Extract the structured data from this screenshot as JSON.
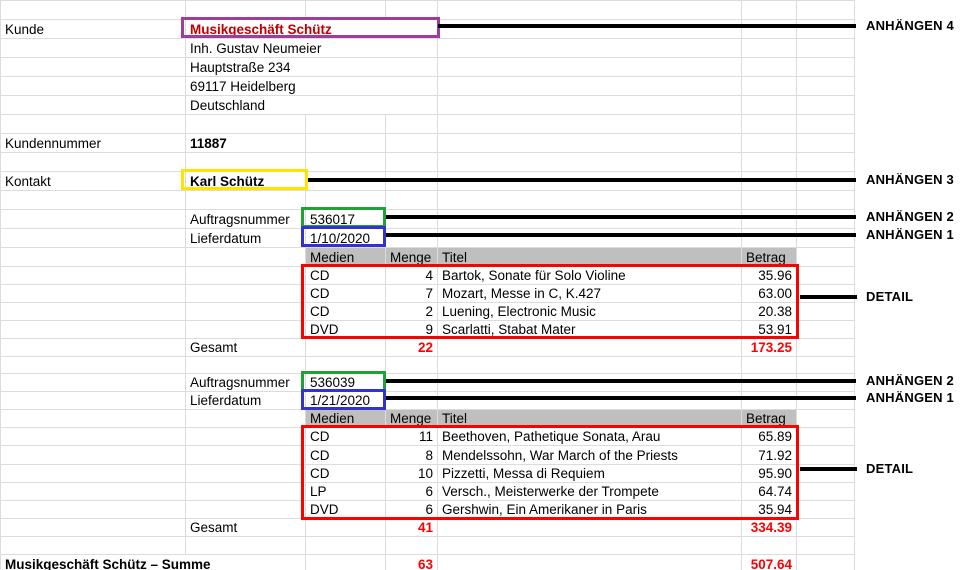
{
  "customer": {
    "label": "Kunde",
    "name": "Musikgeschäft Schütz",
    "address_lines": [
      "Inh. Gustav Neumeier",
      "Hauptstraße 234",
      "69117 Heidelberg",
      "Deutschland"
    ],
    "number_label": "Kundennummer",
    "number": "11887",
    "contact_label": "Kontakt",
    "contact": "Karl Schütz"
  },
  "orders": [
    {
      "order_number_label": "Auftragsnummer",
      "order_number": "536017",
      "delivery_date_label": "Lieferdatum",
      "delivery_date": "1/10/2020",
      "columns": [
        "Medien",
        "Menge",
        "Titel",
        "Betrag"
      ],
      "rows": [
        {
          "medien": "CD",
          "menge": "4",
          "titel": "Bartok, Sonate für Solo Violine",
          "betrag": "35.96"
        },
        {
          "medien": "CD",
          "menge": "7",
          "titel": "Mozart, Messe in C, K.427",
          "betrag": "63.00"
        },
        {
          "medien": "CD",
          "menge": "2",
          "titel": "Luening, Electronic Music",
          "betrag": "20.38"
        },
        {
          "medien": "DVD",
          "menge": "9",
          "titel": "Scarlatti, Stabat Mater",
          "betrag": "53.91"
        }
      ],
      "total_label": "Gesamt",
      "total_menge": "22",
      "total_betrag": "173.25"
    },
    {
      "order_number_label": "Auftragsnummer",
      "order_number": "536039",
      "delivery_date_label": "Lieferdatum",
      "delivery_date": "1/21/2020",
      "columns": [
        "Medien",
        "Menge",
        "Titel",
        "Betrag"
      ],
      "rows": [
        {
          "medien": "CD",
          "menge": "11",
          "titel": "Beethoven, Pathetique Sonata, Arau",
          "betrag": "65.89"
        },
        {
          "medien": "CD",
          "menge": "8",
          "titel": "Mendelssohn, War March of the Priests",
          "betrag": "71.92"
        },
        {
          "medien": "CD",
          "menge": "10",
          "titel": "Pizzetti, Messa di Requiem",
          "betrag": "95.90"
        },
        {
          "medien": "LP",
          "menge": "6",
          "titel": "Versch., Meisterwerke der Trompete",
          "betrag": "64.74"
        },
        {
          "medien": "DVD",
          "menge": "6",
          "titel": "Gershwin, Ein Amerikaner in Paris",
          "betrag": "35.94"
        }
      ],
      "total_label": "Gesamt",
      "total_menge": "41",
      "total_betrag": "334.39"
    }
  ],
  "summary": {
    "label": "Musikgeschäft Schütz – Summe",
    "menge": "63",
    "betrag": "507.64"
  },
  "annotations": {
    "attach4": "ANHÄNGEN 4",
    "attach3": "ANHÄNGEN 3",
    "attach2": "ANHÄNGEN 2",
    "attach1": "ANHÄNGEN 1",
    "detail": "DETAIL"
  },
  "colors": {
    "customer_name_text": "#c00000",
    "totals_text": "#ff0000",
    "header_fill": "#bfbfbf",
    "gridline": "#dcdcdc",
    "callout_purple": "#9e3d9b",
    "callout_yellow": "#ffe400",
    "callout_green": "#21a038",
    "callout_blue": "#3333cc",
    "callout_red": "#ff0000",
    "connector_line": "#000000"
  }
}
